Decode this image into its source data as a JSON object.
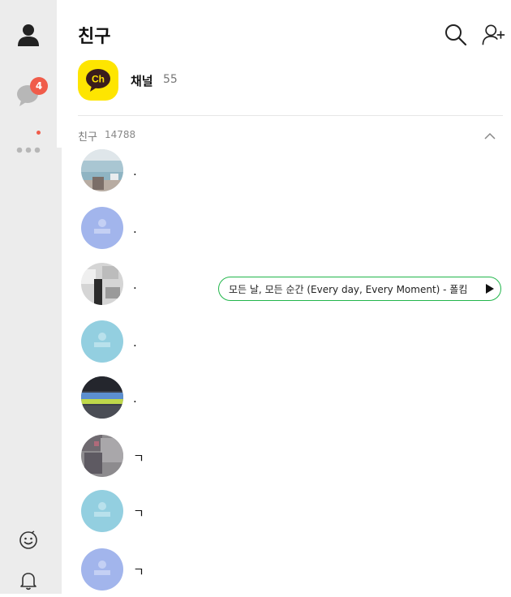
{
  "sidebar": {
    "chat_badge": "4",
    "items": [
      {
        "name": "friends-tab",
        "icon": "person-icon"
      },
      {
        "name": "chats-tab",
        "icon": "speech-bubble-icon"
      },
      {
        "name": "more-tab",
        "icon": "more-dots-icon"
      },
      {
        "name": "emoticon",
        "icon": "smiley-icon"
      },
      {
        "name": "notifications",
        "icon": "bell-icon"
      }
    ]
  },
  "header": {
    "title": "친구",
    "icons": [
      "search-icon",
      "add-friend-icon"
    ]
  },
  "channel": {
    "logo_text": "Ch",
    "name": "채널",
    "count": "55"
  },
  "friends_section": {
    "label": "친구",
    "count": "14788"
  },
  "friends": [
    {
      "name": ".",
      "avatar": "photo-blue-scene"
    },
    {
      "name": ".",
      "avatar": "default-purple"
    },
    {
      "name": ".",
      "avatar": "photo-grey-scene"
    },
    {
      "name": ".",
      "avatar": "default-lightblue"
    },
    {
      "name": ".",
      "avatar": "photo-dark-scene"
    },
    {
      "name": "ㄱ",
      "avatar": "photo-grey-person"
    },
    {
      "name": "ㄱ",
      "avatar": "default-lightblue"
    },
    {
      "name": "ㄱ",
      "avatar": "default-purple"
    }
  ],
  "music_status": {
    "text": "모든 날, 모든 순간 (Every day, Every Moment) - 폴킴"
  },
  "colors": {
    "sidebar_bg": "#ececec",
    "badge": "#f05c4a",
    "channel_yellow": "#fee500",
    "music_border": "#21b64b",
    "default_purple": "#a2b5ec",
    "default_lightblue": "#93cfe0"
  }
}
